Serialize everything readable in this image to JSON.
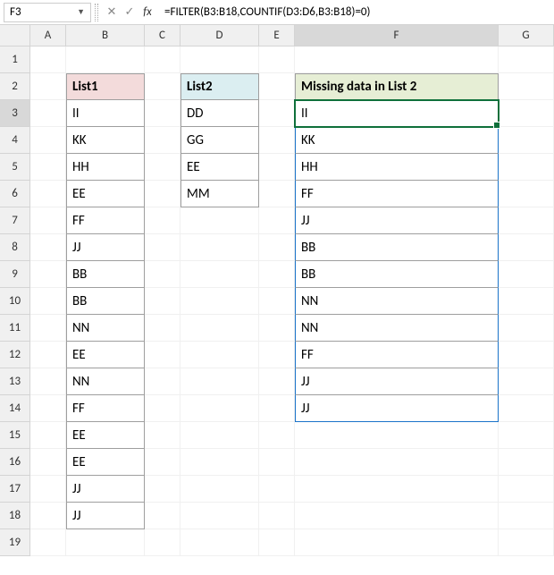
{
  "active_cell_ref": "F3",
  "formula": "=FILTER(B3:B18,COUNTIF(D3:D6,B3:B18)=0)",
  "col_headers": [
    "A",
    "B",
    "C",
    "D",
    "E",
    "F",
    "G"
  ],
  "row_count": 19,
  "headers": {
    "list1": "List1",
    "list2": "List2",
    "missing": "Missing data in List 2"
  },
  "list1": [
    "II",
    "KK",
    "HH",
    "EE",
    "FF",
    "JJ",
    "BB",
    "BB",
    "NN",
    "EE",
    "NN",
    "FF",
    "EE",
    "EE",
    "JJ",
    "JJ"
  ],
  "list2": [
    "DD",
    "GG",
    "EE",
    "MM"
  ],
  "missing": [
    "II",
    "KK",
    "HH",
    "FF",
    "JJ",
    "BB",
    "BB",
    "NN",
    "NN",
    "FF",
    "JJ",
    "JJ"
  ]
}
